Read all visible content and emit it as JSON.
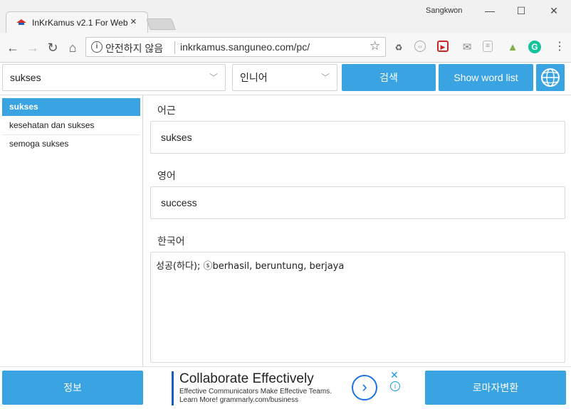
{
  "browser": {
    "tab_title": "InKrKamus v2.1 For Web",
    "tab_close": "×",
    "user": "Sangkwon",
    "win_minimize": "—",
    "win_maximize": "☐",
    "win_close": "✕",
    "security_label": "안전하지 않음",
    "url": "inkrkamus.sanguneo.com/pc/"
  },
  "search": {
    "query": "sukses",
    "language": "인니어",
    "search_button": "검색",
    "word_list_button": "Show word list"
  },
  "sidebar": {
    "items": [
      {
        "label": "sukses"
      },
      {
        "label": "kesehatan dan sukses"
      },
      {
        "label": "semoga sukses"
      }
    ]
  },
  "fields": {
    "root_label": "어근",
    "root_value": "sukses",
    "english_label": "영어",
    "english_value": "success",
    "korean_label": "한국어",
    "korean_value": "성공(하다); ⓢberhasil, beruntung, berjaya"
  },
  "bottom": {
    "info_button": "정보",
    "romanize_button": "로마자변환",
    "ad": {
      "headline": "Collaborate Effectively",
      "line1": "Effective Communicators Make Effective Teams.",
      "line2": "Learn More! grammarly.com/business"
    }
  },
  "colors": {
    "accent": "#3aa4e2"
  }
}
